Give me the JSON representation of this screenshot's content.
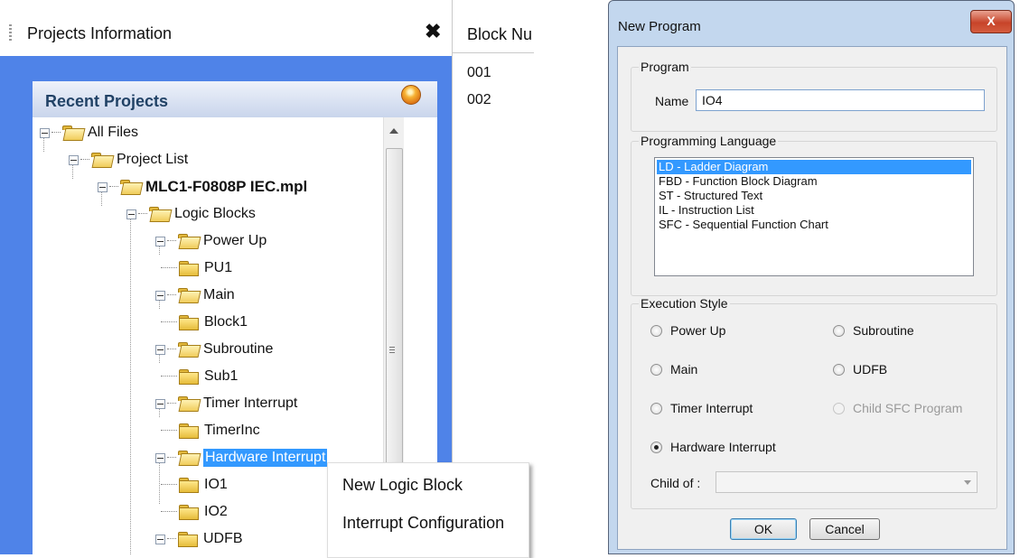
{
  "projects_panel": {
    "title": "Projects Information",
    "close": "✖",
    "recent_title": "Recent Projects"
  },
  "tree": {
    "all_files": "All Files",
    "project_list": "Project List",
    "project_file": "MLC1-F0808P IEC.mpl",
    "logic_blocks": "Logic Blocks",
    "power_up": "Power Up",
    "pu1": "PU1",
    "main": "Main",
    "block1": "Block1",
    "subroutine": "Subroutine",
    "sub1": "Sub1",
    "timer_interrupt": "Timer Interrupt",
    "timerinc": "TimerInc",
    "hardware_interrupt": "Hardware Interrupt",
    "io1": "IO1",
    "io2": "IO2",
    "udfb": "UDFB"
  },
  "block_number": {
    "header": "Block Nu",
    "rows": [
      "001",
      "002"
    ]
  },
  "context_menu": {
    "items": [
      "New Logic Block",
      "Interrupt Configuration"
    ]
  },
  "dialog": {
    "title": "New Program",
    "close": "X",
    "program_group": "Program",
    "name_label": "Name",
    "name_value": "IO4",
    "language_group": "Programming Language",
    "languages": [
      "LD - Ladder Diagram",
      "FBD - Function Block Diagram",
      "ST - Structured Text",
      "IL - Instruction List",
      "SFC - Sequential Function Chart"
    ],
    "selected_language": "LD - Ladder Diagram",
    "execution_group": "Execution Style",
    "styles": {
      "power_up": "Power Up",
      "subroutine": "Subroutine",
      "main": "Main",
      "udfb": "UDFB",
      "timer_interrupt": "Timer Interrupt",
      "child_sfc": "Child SFC Program",
      "hardware_interrupt": "Hardware Interrupt"
    },
    "selected_style": "Hardware Interrupt",
    "child_of_label": "Child of :",
    "child_of_value": "",
    "ok": "OK",
    "cancel": "Cancel"
  },
  "colors": {
    "panel_blue": "#4f83e8",
    "selection": "#3399ff",
    "dialog_frame": "#c3d7ee"
  }
}
